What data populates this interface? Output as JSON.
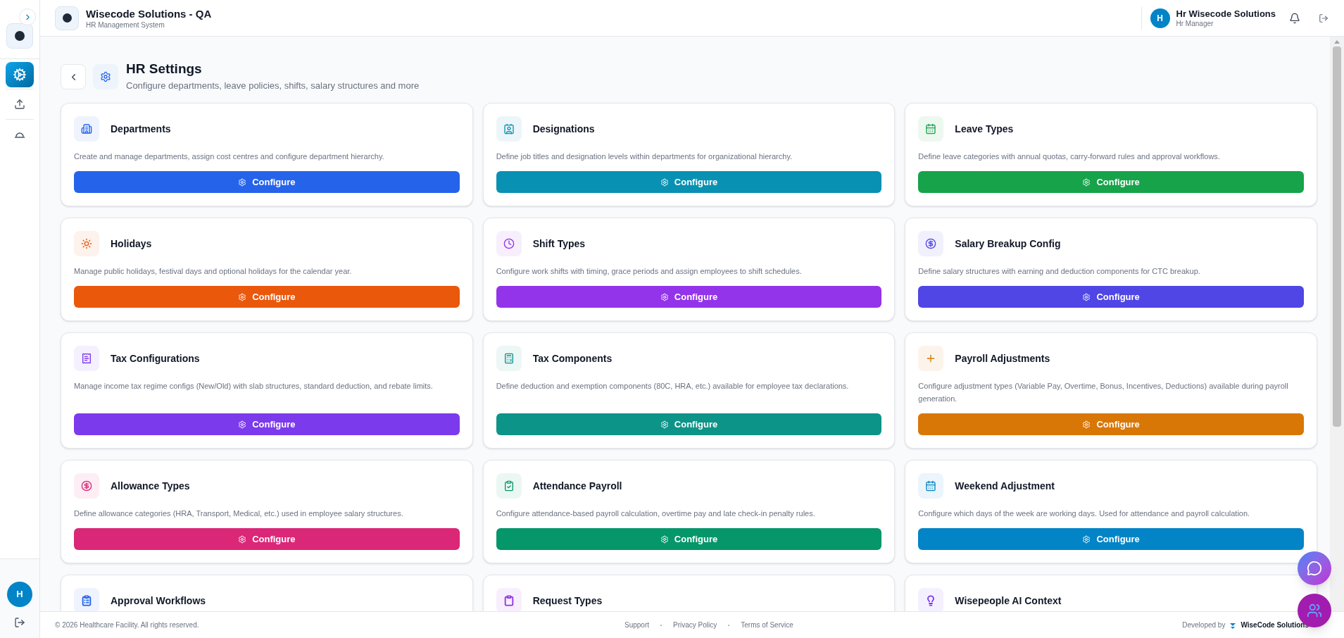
{
  "sidebar": {
    "items": [
      {
        "kind": "apps",
        "selected": true
      },
      {
        "kind": "upload",
        "selected": false
      },
      {
        "kind": "dome",
        "selected": false
      }
    ],
    "user_initial": "H"
  },
  "header": {
    "title": "Wisecode Solutions - QA",
    "subtitle": "HR Management System",
    "user": {
      "initial": "H",
      "name": "Hr Wisecode Solutions",
      "role": "Hr Manager"
    }
  },
  "page": {
    "title": "HR Settings",
    "subtitle": "Configure departments, leave policies, shifts, salary structures and more"
  },
  "cards": [
    {
      "kind": "building",
      "color": "#2563eb",
      "title": "Departments",
      "description": "Create and manage departments, assign cost centres and configure department hierarchy.",
      "button": "Configure"
    },
    {
      "kind": "id-card",
      "color": "#0891b2",
      "title": "Designations",
      "description": "Define job titles and designation levels within departments for organizational hierarchy.",
      "button": "Configure"
    },
    {
      "kind": "calendar",
      "color": "#16a34a",
      "title": "Leave Types",
      "description": "Define leave categories with annual quotas, carry-forward rules and approval workflows.",
      "button": "Configure"
    },
    {
      "kind": "sun",
      "color": "#ea580c",
      "title": "Holidays",
      "description": "Manage public holidays, festival days and optional holidays for the calendar year.",
      "button": "Configure"
    },
    {
      "kind": "clock",
      "color": "#9333ea",
      "title": "Shift Types",
      "description": "Configure work shifts with timing, grace periods and assign employees to shift schedules.",
      "button": "Configure"
    },
    {
      "kind": "dollar",
      "color": "#4f46e5",
      "title": "Salary Breakup Config",
      "description": "Define salary structures with earning and deduction components for CTC breakup.",
      "button": "Configure"
    },
    {
      "kind": "receipt",
      "color": "#7c3aed",
      "title": "Tax Configurations",
      "description": "Manage income tax regime configs (New/Old) with slab structures, standard deduction, and rebate limits.",
      "button": "Configure"
    },
    {
      "kind": "calculator",
      "color": "#0d9488",
      "title": "Tax Components",
      "description": "Define deduction and exemption components (80C, HRA, etc.) available for employee tax declarations.",
      "button": "Configure"
    },
    {
      "kind": "plus",
      "color": "#d97706",
      "title": "Payroll Adjustments",
      "description": "Configure adjustment types (Variable Pay, Overtime, Bonus, Incentives, Deductions) available during payroll generation.",
      "button": "Configure"
    },
    {
      "kind": "dollar",
      "color": "#db2777",
      "title": "Allowance Types",
      "description": "Define allowance categories (HRA, Transport, Medical, etc.) used in employee salary structures.",
      "button": "Configure"
    },
    {
      "kind": "clipboard-check",
      "color": "#059669",
      "title": "Attendance Payroll",
      "description": "Configure attendance-based payroll calculation, overtime pay and late check-in penalty rules.",
      "button": "Configure"
    },
    {
      "kind": "calendar",
      "color": "#0284c7",
      "title": "Weekend Adjustment",
      "description": "Configure which days of the week are working days. Used for attendance and payroll calculation.",
      "button": "Configure"
    },
    {
      "kind": "clipboard-list",
      "color": "#2563eb",
      "title": "Approval Workflows"
    },
    {
      "kind": "clipboard",
      "color": "#9333ea",
      "title": "Request Types"
    },
    {
      "kind": "bulb",
      "color": "#7c3aed",
      "title": "Wisepeople AI Context"
    }
  ],
  "footer": {
    "copyright": "© 2026 Healthcare Facility. All rights reserved.",
    "links": [
      "Support",
      "Privacy Policy",
      "Terms of Service"
    ],
    "developed_by": "Developed by",
    "brand": "WiseCode Solutions"
  }
}
